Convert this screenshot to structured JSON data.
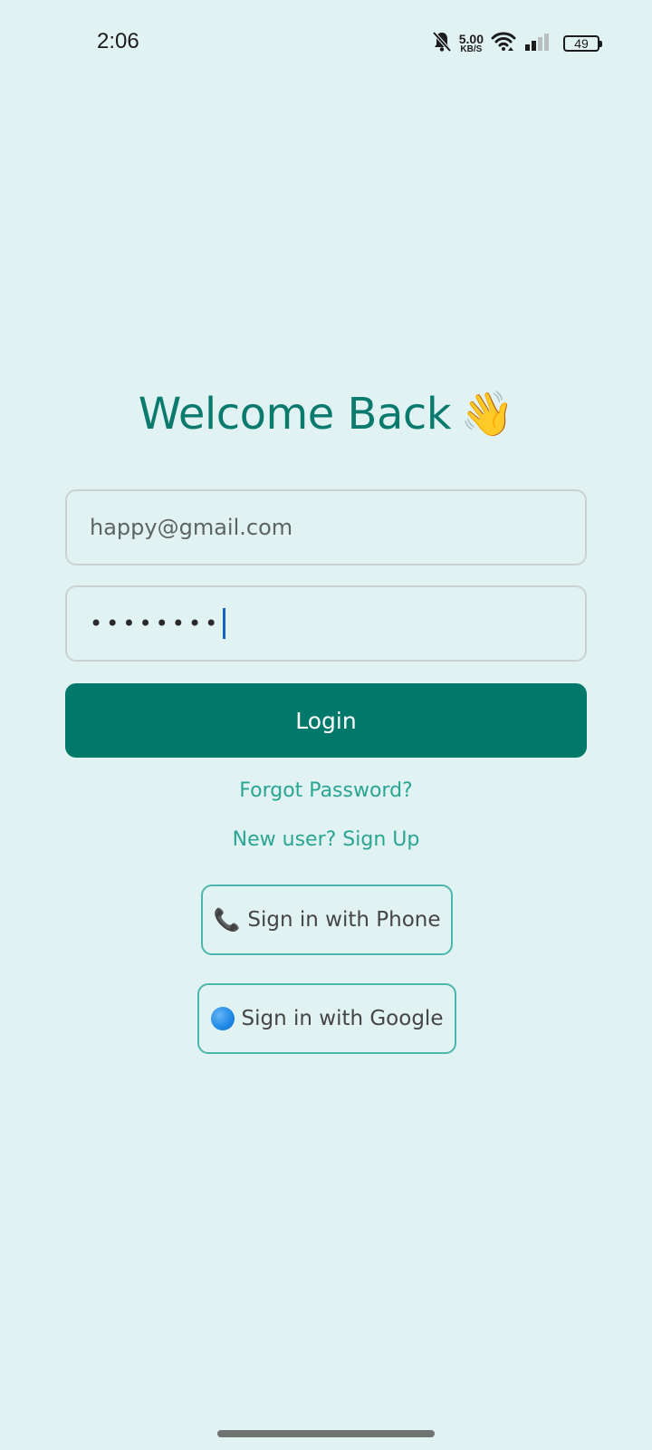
{
  "status_bar": {
    "time": "2:06",
    "net_speed_value": "5.00",
    "net_speed_unit": "KB/S",
    "battery_level": "49",
    "icons": [
      "bell-off-icon",
      "wifi-icon",
      "signal-icon",
      "battery-icon"
    ]
  },
  "login": {
    "title": "Welcome Back",
    "title_emoji": "👋",
    "email_value": "happy@gmail.com",
    "password_value": "••••••••",
    "login_label": "Login",
    "forgot_label": "Forgot Password?",
    "signup_label": "New user? Sign Up",
    "phone_icon": "📞",
    "phone_label": "Sign in with Phone",
    "google_label": "Sign in with Google"
  },
  "colors": {
    "background": "#e0f2f1",
    "primary": "#00796b",
    "title": "#0b7a6e",
    "link": "#2aa593",
    "outline": "#4db6ac",
    "caret": "#1565c0"
  }
}
